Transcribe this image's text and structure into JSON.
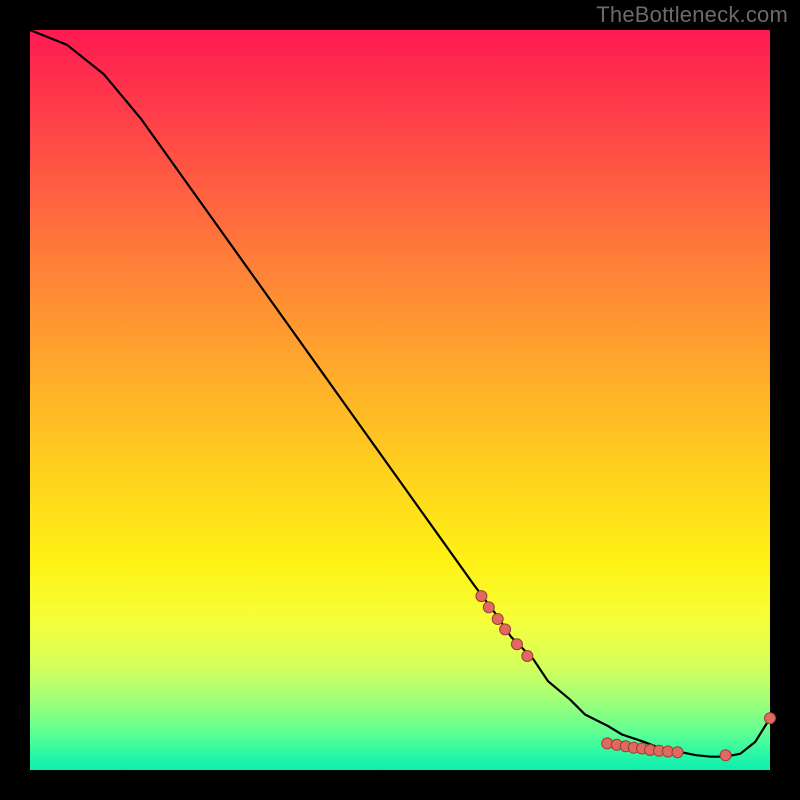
{
  "watermark": "TheBottleneck.com",
  "chart_data": {
    "type": "line",
    "title": "",
    "xlabel": "",
    "ylabel": "",
    "xlim": [
      0,
      100
    ],
    "ylim": [
      0,
      100
    ],
    "grid": false,
    "series": [
      {
        "name": "curve",
        "x": [
          0,
          5,
          10,
          15,
          20,
          25,
          30,
          35,
          40,
          45,
          50,
          55,
          60,
          63,
          65,
          68,
          70,
          73,
          75,
          78,
          80,
          83,
          85,
          88,
          90,
          92,
          94,
          96,
          98,
          100
        ],
        "y": [
          100,
          98,
          94,
          88,
          81,
          74,
          67,
          60,
          53,
          46,
          39,
          32,
          25,
          21,
          18,
          15,
          12,
          9.5,
          7.5,
          6,
          4.8,
          3.8,
          3.0,
          2.4,
          2.0,
          1.8,
          1.8,
          2.2,
          3.8,
          7
        ]
      }
    ],
    "marker_groups": [
      {
        "name": "upper-slope-dots",
        "points": [
          {
            "x": 61,
            "y": 23.5
          },
          {
            "x": 62,
            "y": 22.0
          },
          {
            "x": 63.2,
            "y": 20.4
          },
          {
            "x": 64.2,
            "y": 19.0
          },
          {
            "x": 65.8,
            "y": 17.0
          },
          {
            "x": 67.2,
            "y": 15.4
          }
        ]
      },
      {
        "name": "floor-dots",
        "points": [
          {
            "x": 78,
            "y": 3.6
          },
          {
            "x": 79.3,
            "y": 3.4
          },
          {
            "x": 80.5,
            "y": 3.2
          },
          {
            "x": 81.6,
            "y": 3.0
          },
          {
            "x": 82.7,
            "y": 2.9
          },
          {
            "x": 83.8,
            "y": 2.7
          },
          {
            "x": 85.0,
            "y": 2.6
          },
          {
            "x": 86.2,
            "y": 2.5
          },
          {
            "x": 87.5,
            "y": 2.4
          }
        ]
      },
      {
        "name": "single-dot-right",
        "points": [
          {
            "x": 94,
            "y": 2.0
          }
        ]
      },
      {
        "name": "end-dot",
        "points": [
          {
            "x": 100,
            "y": 7
          }
        ]
      }
    ],
    "colors": {
      "line": "#000000",
      "dot_fill": "#e06a60",
      "dot_stroke": "#9e3d36",
      "gradient_top": "#ff1a52",
      "gradient_bottom": "#0ceeb0"
    }
  }
}
